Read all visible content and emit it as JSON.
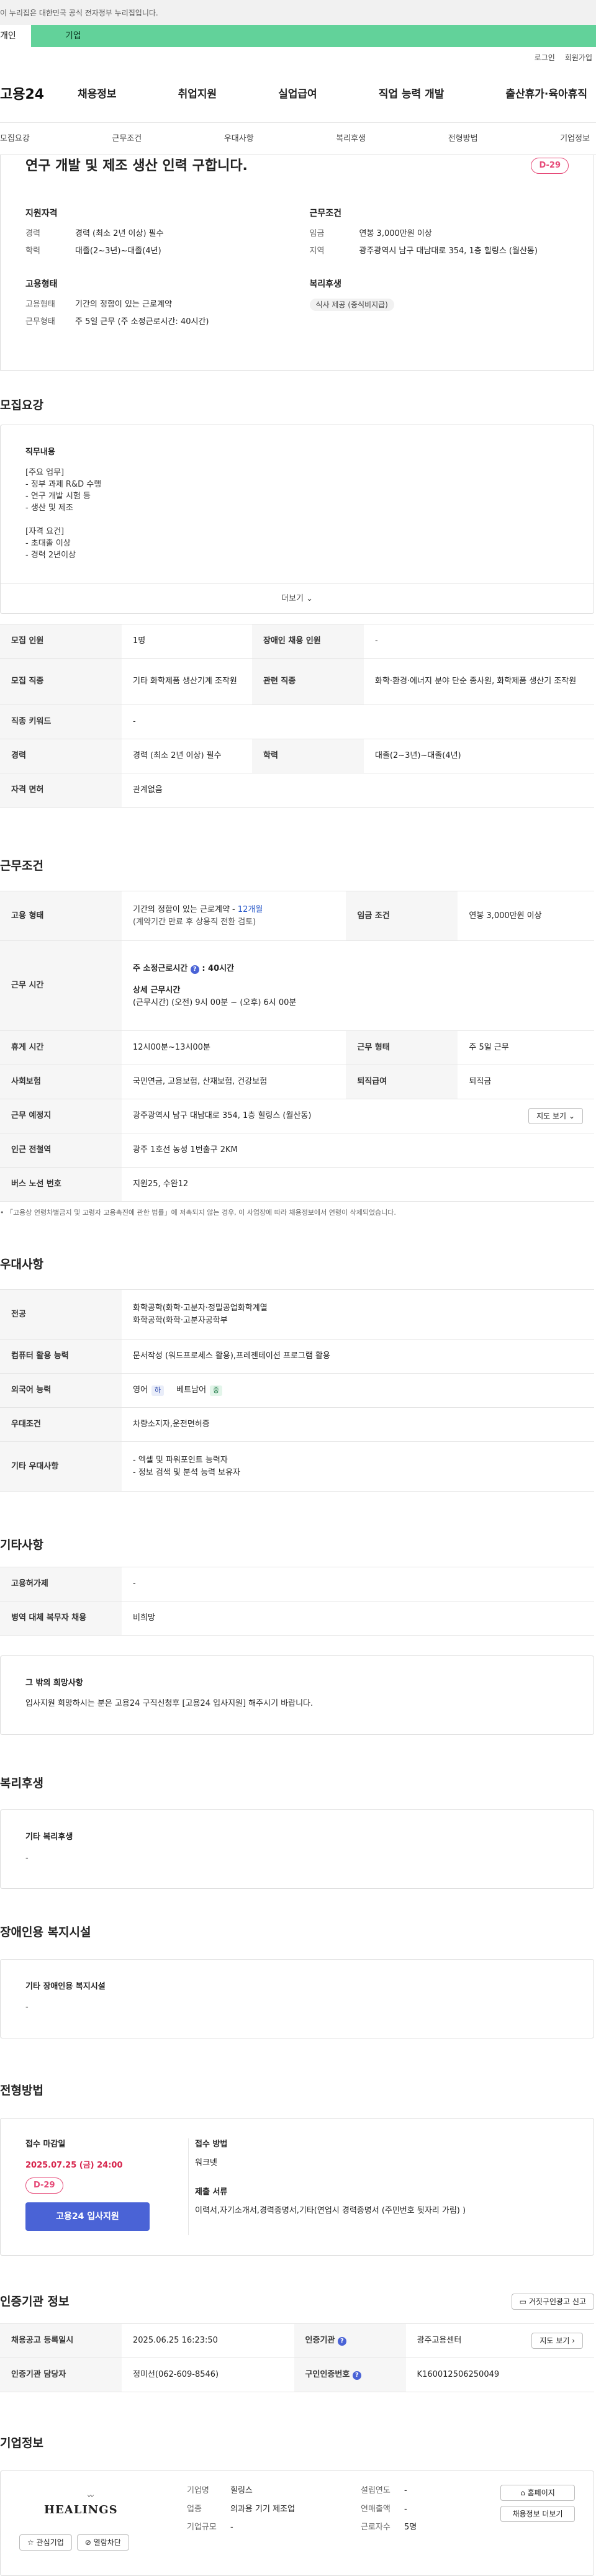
{
  "gov_banner": "이 누리집은 대한민국 공식 전자정부 누리집입니다.",
  "tabs": [
    "개인",
    "기업"
  ],
  "util_links": [
    "로그인",
    "회원가입"
  ],
  "gnb": {
    "logo": "고용24",
    "menu": [
      "채용정보",
      "취업지원",
      "실업급여",
      "직업 능력 개발",
      "출산휴가·육아휴직"
    ]
  },
  "subnav": [
    "모집요강",
    "근무조건",
    "우대사항",
    "복리후생",
    "전형방법",
    "기업정보"
  ],
  "hero": {
    "title": "연구 개발 및 제조 생산 인력 구합니다.",
    "dday": "D-29",
    "qualification": {
      "heading": "지원자격",
      "rows": [
        {
          "k": "경력",
          "v": "경력 (최소 2년 이상) 필수"
        },
        {
          "k": "학력",
          "v": "대졸(2~3년)~대졸(4년)"
        }
      ]
    },
    "conditions": {
      "heading": "근무조건",
      "rows": [
        {
          "k": "임금",
          "v": "연봉 3,000만원 이상"
        },
        {
          "k": "지역",
          "v": "광주광역시 남구 대남대로 354, 1층 힐링스 (월산동)"
        }
      ]
    },
    "employment": {
      "heading": "고용형태",
      "rows": [
        {
          "k": "고용형태",
          "v": "기간의 정함이 있는 근로계약"
        },
        {
          "k": "근무형태",
          "v": "주 5일 근무 (주 소정근로시간: 40시간)"
        }
      ]
    },
    "welfare": {
      "heading": "복리후생",
      "chip": "식사 제공 (중식비지급)"
    }
  },
  "recruit": {
    "title": "모집요강",
    "duty_heading": "직무내용",
    "duty_lines": [
      "[주요 업무]",
      "- 정부 과제 R&D 수행",
      "- 연구 개발 시험 등",
      "- 생산 및 제조",
      "",
      "[자격 요건]",
      "- 초대졸 이상",
      "- 경력 2년이상"
    ],
    "more": "더보기",
    "rows": [
      [
        "모집 인원",
        "1명",
        "장애인 채용 인원",
        "-"
      ],
      [
        "모집 직종",
        "기타 화학제품 생산기계 조작원",
        "관련 직종",
        "화학·환경·에너지 분야 단순 종사원, 화학제품 생산기 조작원"
      ],
      [
        "직종 키워드",
        "-",
        "",
        ""
      ],
      [
        "경력",
        "경력 (최소 2년 이상) 필수",
        "학력",
        "대졸(2~3년)~대졸(4년)"
      ],
      [
        "자격 면허",
        "관계없음",
        "",
        ""
      ]
    ]
  },
  "work": {
    "title": "근무조건",
    "employ_type_label": "고용 형태",
    "employ_type_main": "기간의 정함이 있는 근로계약 - ",
    "employ_type_months": "12개월",
    "employ_type_note": "(계약기간 만료 후 상용직 전환 검토)",
    "wage_label": "임금 조건",
    "wage_value": "연봉 3,000만원 이상",
    "hours_label": "근무 시간",
    "hours_main": "주 소정근로시간",
    "hours_total": ": 40시간",
    "hours_detail_head": "상세 근무시간",
    "hours_detail": "(근무시간) (오전) 9시 00분 ~ (오후) 6시 00분",
    "rest_label": "휴게 시간",
    "rest_value": "12시00분~13시00분",
    "form_label": "근무 형태",
    "form_value": "주 5일 근무",
    "insurance_label": "사회보험",
    "insurance_value": "국민연금, 고용보험, 산재보험, 건강보험",
    "retire_label": "퇴직급여",
    "retire_value": "퇴직금",
    "place_label": "근무 예정지",
    "place_value": "광주광역시 남구 대남대로 354, 1층 힐링스 (월산동)",
    "map_button": "지도 보기",
    "station_label": "인근 전철역",
    "station_value": "광주 1호선 농성 1번출구 2KM",
    "bus_label": "버스 노선 번호",
    "bus_value": "지원25, 수완12",
    "law_note": "「고용상 연령차별금지 및 고령자 고용촉진에 관한 법률」에 저촉되지 않는 경우, 이 사업장에 따라 채용정보에서 연령이 삭제되었습니다."
  },
  "pref": {
    "title": "우대사항",
    "major_label": "전공",
    "major_lines": [
      "화학공학(화학·고분자·정밀공업화학계열",
      "화학공학(화학·고분자공학부"
    ],
    "pc_label": "컴퓨터 활용 능력",
    "pc_value": "문서작성 (워드프로세스 활용),프레젠테이션 프로그램 활용",
    "lang_label": "외국어 능력",
    "lang_items": [
      {
        "name": "영어",
        "level": "하"
      },
      {
        "name": "베트남어",
        "level": "중"
      }
    ],
    "cond_label": "우대조건",
    "cond_value": "차량소지자,운전면허증",
    "etc_label": "기타 우대사항",
    "etc_lines": [
      "- 엑셀 및 파워포인트 능력자",
      "- 정보 검색 및 분석 능력 보유자"
    ]
  },
  "etc": {
    "title": "기타사항",
    "rows": [
      [
        "고용허가제",
        "-"
      ],
      [
        "병역 대체 복무자 채용",
        "비희망"
      ]
    ],
    "wish_title": "그 밖의 희망사항",
    "wish_text": "입사지원 희망하시는 분은 고용24 구직신청후 [고용24 입사지원] 해주시기 바랍니다."
  },
  "benefit": {
    "title": "복리후생",
    "box_title": "기타 복리후생",
    "box_value": "-"
  },
  "disability": {
    "title": "장애인용 복지시설",
    "box_title": "기타 장애인용 복지시설",
    "box_value": "-"
  },
  "process": {
    "title": "전형방법",
    "deadline_label": "접수 마감일",
    "deadline": "2025.07.25 (금) 24:00",
    "dday": "D-29",
    "apply_button": "고용24 입사지원",
    "method_label": "접수 방법",
    "method_value": "워크넷",
    "docs_label": "제출 서류",
    "docs_value": "이력서,자기소개서,경력증명서,기타(연업시 경력증명서 (주민번호 뒷자리 가림) )"
  },
  "auth": {
    "title": "인증기관 정보",
    "other_button": "거짓구인광고 신고",
    "rows": [
      [
        "채용공고 등록일시",
        "2025.06.25 16:23:50",
        "인증기관",
        "광주고용센터"
      ],
      [
        "인증기관 담당자",
        "정미선(062-609-8546)",
        "구인인증번호",
        "K160012506250049"
      ]
    ],
    "map_button": "지도 보기"
  },
  "company": {
    "title": "기업정보",
    "logo_text": "HEALINGS",
    "fav_button": "관심기업",
    "block_button": "열람차단",
    "info": [
      [
        "기업명",
        "힐링스"
      ],
      [
        "업종",
        "의과용 기기 제조업"
      ],
      [
        "기업규모",
        "-"
      ]
    ],
    "info2": [
      [
        "설립연도",
        "-"
      ],
      [
        "연매출액",
        "-"
      ],
      [
        "근로자수",
        "5명"
      ]
    ],
    "home_button": "홈페이지",
    "list_button": "채용정보 더보기"
  },
  "colors": {
    "accent": "#4a63d6",
    "banner": "#62d29a",
    "dday": "#e64a78"
  }
}
